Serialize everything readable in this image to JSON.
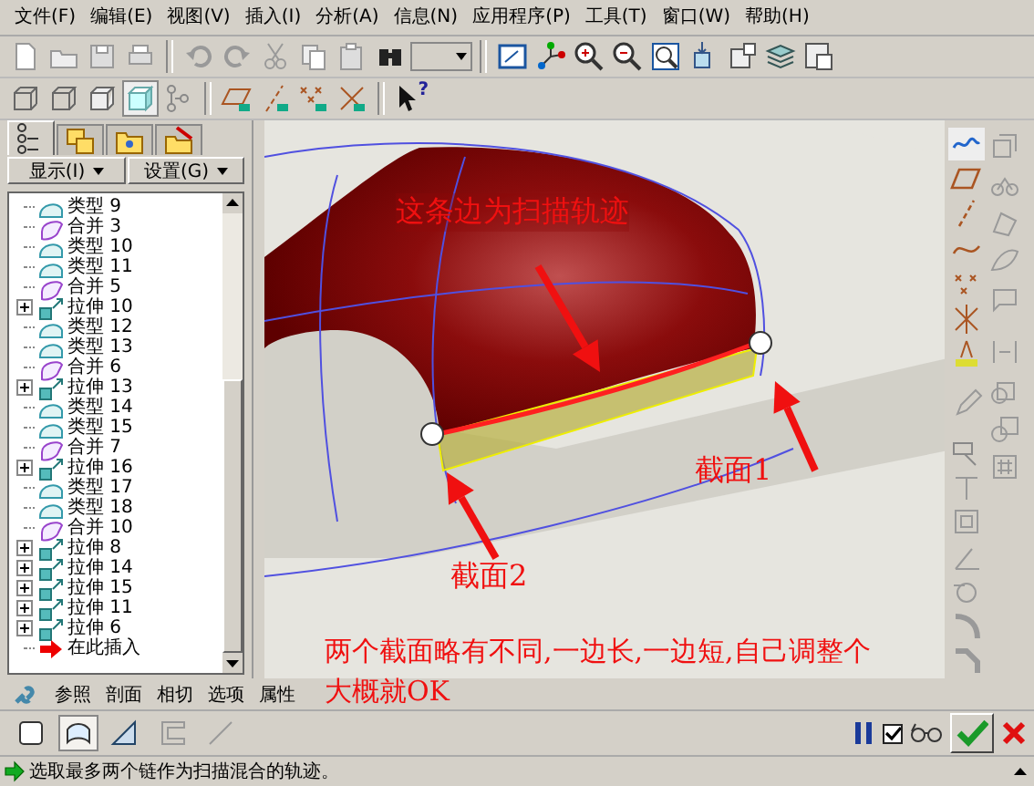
{
  "help_glyph": "?",
  "menu": [
    "文件(F)",
    "编辑(E)",
    "视图(V)",
    "插入(I)",
    "分析(A)",
    "信息(N)",
    "应用程序(P)",
    "工具(T)",
    "窗口(W)",
    "帮助(H)"
  ],
  "model_tree": {
    "tabs": [
      {
        "selected": true
      },
      {
        "selected": false
      },
      {
        "selected": false
      },
      {
        "selected": false
      }
    ],
    "buttons": [
      "显示(I)",
      "设置(G)"
    ],
    "items": [
      {
        "kind": "blend",
        "label": "类型 9"
      },
      {
        "kind": "merge",
        "label": "合并 3"
      },
      {
        "kind": "blend",
        "label": "类型 10"
      },
      {
        "kind": "blend",
        "label": "类型 11"
      },
      {
        "kind": "merge",
        "label": "合并 5"
      },
      {
        "kind": "extrude",
        "label": "拉伸 10"
      },
      {
        "kind": "blend",
        "label": "类型 12"
      },
      {
        "kind": "blend",
        "label": "类型 13"
      },
      {
        "kind": "merge",
        "label": "合并 6"
      },
      {
        "kind": "extrude",
        "label": "拉伸 13"
      },
      {
        "kind": "blend",
        "label": "类型 14"
      },
      {
        "kind": "blend",
        "label": "类型 15"
      },
      {
        "kind": "merge",
        "label": "合并 7"
      },
      {
        "kind": "extrude",
        "label": "拉伸 16"
      },
      {
        "kind": "blend",
        "label": "类型 17"
      },
      {
        "kind": "blend",
        "label": "类型 18"
      },
      {
        "kind": "merge",
        "label": "合并 10"
      },
      {
        "kind": "extrude",
        "label": "拉伸 8"
      },
      {
        "kind": "extrude",
        "label": "拉伸 14"
      },
      {
        "kind": "extrude",
        "label": "拉伸 15"
      },
      {
        "kind": "extrude",
        "label": "拉伸 11"
      },
      {
        "kind": "extrude",
        "label": "拉伸 6"
      },
      {
        "kind": "insert",
        "label": "在此插入"
      }
    ]
  },
  "viewport": {
    "annotations": [
      {
        "kind": "trajectory",
        "text": "这条边为扫描轨迹"
      },
      {
        "kind": "section_1",
        "text": "截面1"
      },
      {
        "kind": "section_2",
        "text": "截面2"
      }
    ],
    "note": "两个截面略有不同,一边长,一边短,自己调整个大概就OK"
  },
  "dashboard": {
    "tabs": [
      "参照",
      "剖面",
      "相切",
      "选项",
      "属性"
    ],
    "tools": [
      {
        "selected": false
      },
      {
        "selected": true
      },
      {
        "selected": false
      },
      {
        "selected": false
      },
      {
        "selected": false
      }
    ],
    "preview_checked": true
  },
  "status_bar": {
    "message": "选取最多两个链作为扫描混合的轨迹。"
  }
}
